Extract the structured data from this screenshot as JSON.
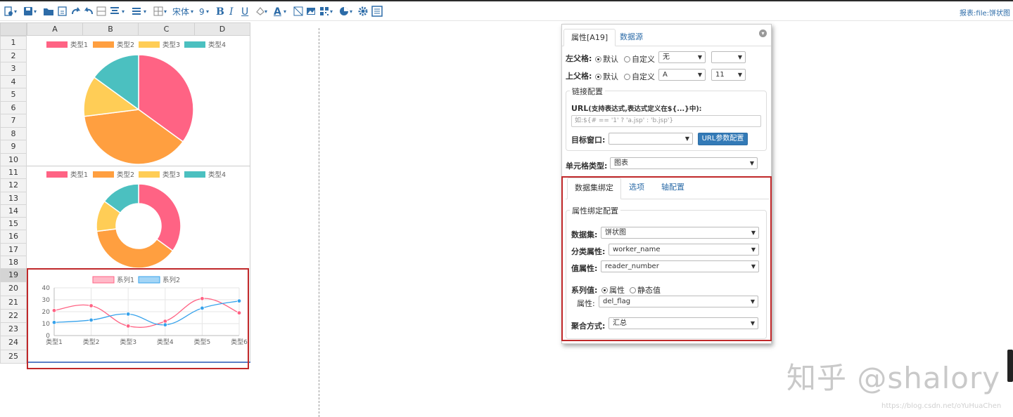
{
  "toolbar": {
    "font_name": "宋体",
    "font_size": "9",
    "report_label": "报表:file:饼状图"
  },
  "sheet": {
    "columns": [
      "A",
      "B",
      "C",
      "D"
    ],
    "rows": [
      "1",
      "2",
      "3",
      "4",
      "5",
      "6",
      "7",
      "8",
      "9",
      "10",
      "11",
      "12",
      "13",
      "14",
      "15",
      "16",
      "17",
      "18",
      "19",
      "20",
      "21",
      "22",
      "23",
      "24",
      "25"
    ],
    "selected_row": "19"
  },
  "chart_data": [
    {
      "type": "pie",
      "legend": [
        "类型1",
        "类型2",
        "类型3",
        "类型4"
      ],
      "values": [
        35,
        38,
        12,
        15
      ],
      "colors": [
        "#ff6384",
        "#ff9f40",
        "#ffcd56",
        "#4bc0c0"
      ]
    },
    {
      "type": "pie",
      "variant": "doughnut",
      "legend": [
        "类型1",
        "类型2",
        "类型3",
        "类型4"
      ],
      "values": [
        35,
        38,
        12,
        15
      ],
      "colors": [
        "#ff6384",
        "#ff9f40",
        "#ffcd56",
        "#4bc0c0"
      ]
    },
    {
      "type": "line",
      "categories": [
        "类型1",
        "类型2",
        "类型3",
        "类型4",
        "类型5",
        "类型6"
      ],
      "series": [
        {
          "name": "系列1",
          "values": [
            21,
            25,
            8,
            12,
            31,
            19
          ],
          "color": "#ff6384"
        },
        {
          "name": "系列2",
          "values": [
            11,
            13,
            18,
            9,
            23,
            29
          ],
          "color": "#36a2eb"
        }
      ],
      "yticks": [
        "40",
        "30",
        "20",
        "10",
        "0"
      ],
      "ylim": [
        0,
        40
      ]
    }
  ],
  "panel": {
    "tab_props": "属性[A19]",
    "tab_datasource": "数据源",
    "left_parent_label": "左父格:",
    "top_parent_label": "上父格:",
    "radio_default": "默认",
    "radio_custom": "自定义",
    "left_parent_value": "无",
    "left_parent_extra": "",
    "top_parent_value": "A",
    "top_parent_row": "11",
    "link_legend": "链接配置",
    "url_label": "URL",
    "url_hint": "(支持表达式,表达式定义在${...}中):",
    "url_placeholder": "如:${# == '1' ? 'a.jsp' : 'b.jsp'}",
    "target_label": "目标窗口:",
    "target_value": "",
    "url_param_button": "URL参数配置",
    "cell_type_label": "单元格类型:",
    "cell_type_value": "图表",
    "subtabs": [
      "数据集绑定",
      "选项",
      "轴配置"
    ],
    "bind_legend": "属性绑定配置",
    "dataset_label": "数据集:",
    "dataset_value": "饼状图",
    "category_label": "分类属性:",
    "category_value": "worker_name",
    "value_label": "值属性:",
    "value_value": "reader_number",
    "series_label": "系列值:",
    "series_attr": "属性",
    "series_static": "静态值",
    "attr_label": "属性:",
    "attr_value": "del_flag",
    "agg_label": "聚合方式:",
    "agg_value": "汇总"
  },
  "watermark": {
    "text": "知乎 @shalory",
    "url": "https://blog.csdn.net/oYuHuaChen"
  }
}
